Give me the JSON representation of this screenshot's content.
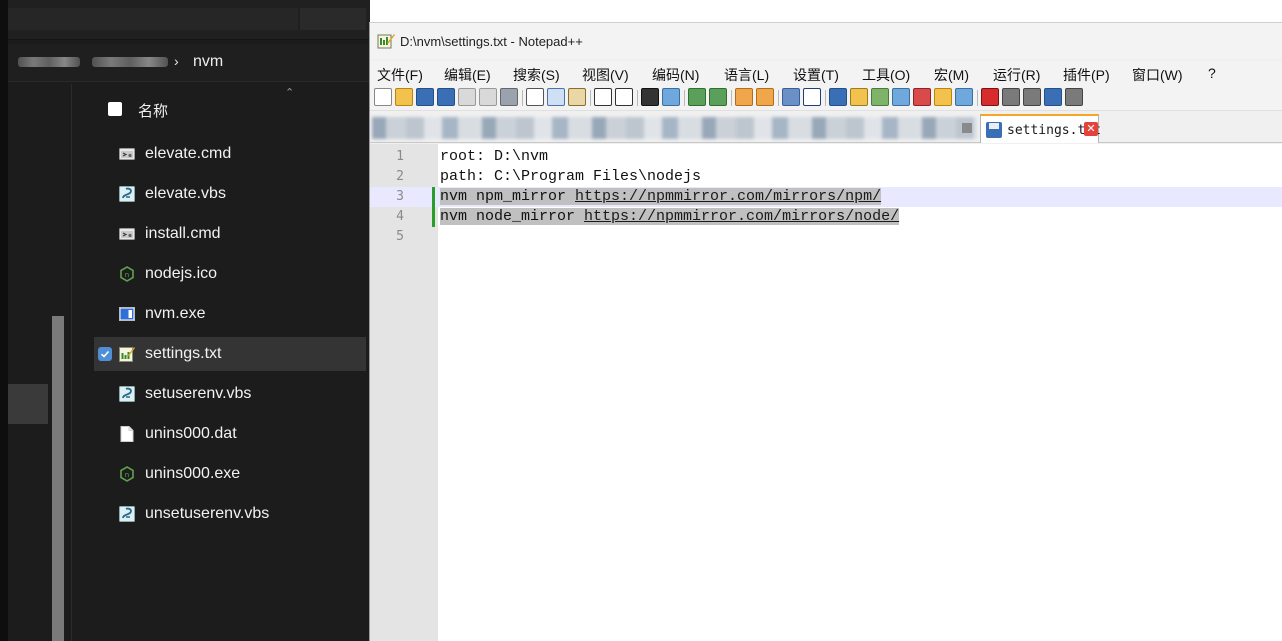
{
  "explorer": {
    "breadcrumb": {
      "separator": "›",
      "current": "nvm"
    },
    "header": {
      "name_column": "名称"
    },
    "files": [
      {
        "name": "elevate.cmd",
        "icon": "cmd-file-icon",
        "selected": false
      },
      {
        "name": "elevate.vbs",
        "icon": "vbs-script-icon",
        "selected": false
      },
      {
        "name": "install.cmd",
        "icon": "cmd-file-icon",
        "selected": false
      },
      {
        "name": "nodejs.ico",
        "icon": "nodejs-icon",
        "selected": false
      },
      {
        "name": "nvm.exe",
        "icon": "exe-file-icon",
        "selected": false
      },
      {
        "name": "settings.txt",
        "icon": "notepadpp-file-icon",
        "selected": true
      },
      {
        "name": "setuserenv.vbs",
        "icon": "vbs-script-icon",
        "selected": false
      },
      {
        "name": "unins000.dat",
        "icon": "blank-file-icon",
        "selected": false
      },
      {
        "name": "unins000.exe",
        "icon": "nodejs-icon",
        "selected": false
      },
      {
        "name": "unsetuserenv.vbs",
        "icon": "vbs-script-icon",
        "selected": false
      }
    ]
  },
  "notepad": {
    "title": "D:\\nvm\\settings.txt - Notepad++",
    "menu": [
      "文件(F)",
      "编辑(E)",
      "搜索(S)",
      "视图(V)",
      "编码(N)",
      "语言(L)",
      "设置(T)",
      "工具(O)",
      "宏(M)",
      "运行(R)",
      "插件(P)",
      "窗口(W)",
      "?"
    ],
    "active_tab": {
      "label": "settings.txt"
    },
    "lines": [
      {
        "num": "1",
        "prefix": "root: D:\\nvm",
        "url": ""
      },
      {
        "num": "2",
        "prefix": "path: C:\\Program Files\\nodejs",
        "url": ""
      },
      {
        "num": "3",
        "prefix": "nvm npm_mirror ",
        "url": "https://npmmirror.com/mirrors/npm/"
      },
      {
        "num": "4",
        "prefix": "nvm node_mirror ",
        "url": "https://npmmirror.com/mirrors/node/"
      },
      {
        "num": "5",
        "prefix": "",
        "url": ""
      }
    ]
  },
  "colors": {
    "explorer_bg": "#1c1c1c",
    "selection_check": "#4e8fd6",
    "modified_marker": "#2a9d2a",
    "current_line": "#e8e8ff",
    "tab_close": "#e2443c"
  }
}
